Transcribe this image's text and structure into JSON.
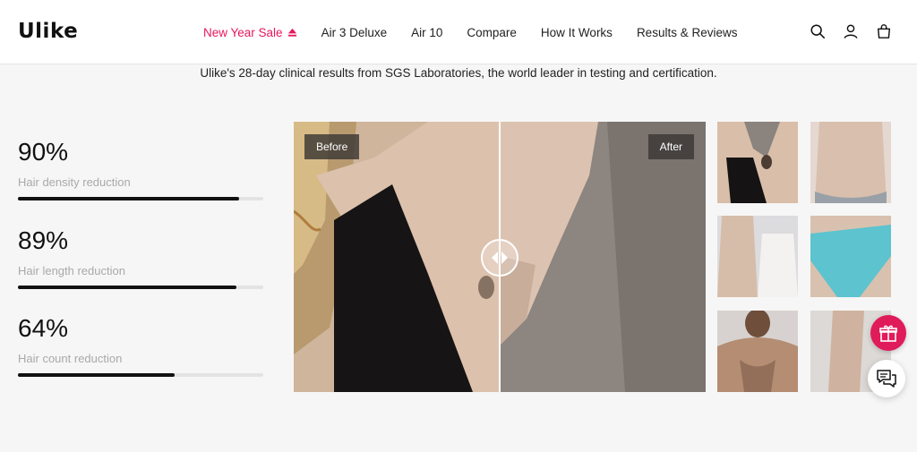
{
  "brand": {
    "logo": "Ulike",
    "accent": "#e6175c"
  },
  "nav": {
    "items": [
      {
        "label": "New Year Sale",
        "icon": "eject-triangle-icon"
      },
      {
        "label": "Air 3 Deluxe"
      },
      {
        "label": "Air 10"
      },
      {
        "label": "Compare"
      },
      {
        "label": "How It Works"
      },
      {
        "label": "Results & Reviews"
      }
    ]
  },
  "header_icons": [
    "search-icon",
    "account-icon",
    "cart-icon"
  ],
  "subtitle": "Ulike's 28-day clinical results from SGS Laboratories, the world leader in testing and certification.",
  "stats": [
    {
      "value": "90%",
      "label": "Hair density reduction",
      "progress": 0.9
    },
    {
      "value": "89%",
      "label": "Hair length reduction",
      "progress": 0.89
    },
    {
      "value": "64%",
      "label": "Hair count reduction",
      "progress": 0.64
    }
  ],
  "compare": {
    "before_label": "Before",
    "after_label": "After"
  },
  "thumbnails": [
    "underarm",
    "torso",
    "arm",
    "bikini",
    "chest",
    "leg"
  ],
  "floating": [
    "gift-icon",
    "chat-icon"
  ]
}
